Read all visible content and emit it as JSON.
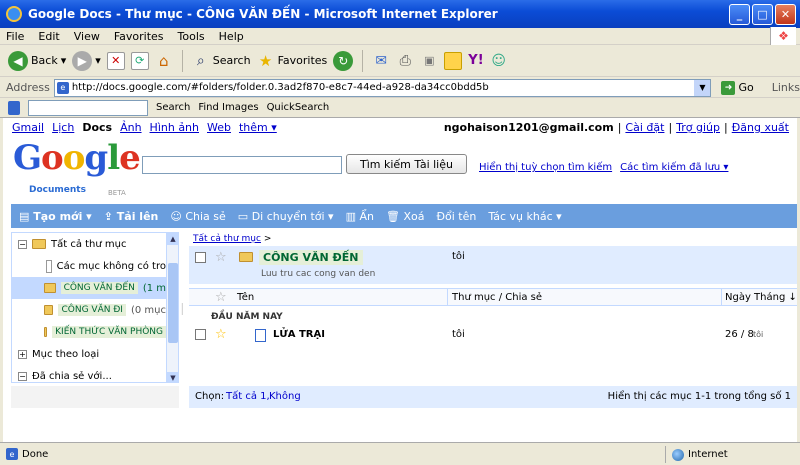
{
  "window": {
    "title": "Google Docs - Thư mục - CÔNG VĂN ĐẾN - Microsoft Internet Explorer"
  },
  "menu": [
    "File",
    "Edit",
    "View",
    "Favorites",
    "Tools",
    "Help"
  ],
  "toolbar": {
    "back": "Back",
    "search": "Search",
    "favorites": "Favorites"
  },
  "address": {
    "label": "Address",
    "url": "http://docs.google.com/#folders/folder.0.3ad2f870-e8c7-44ed-a928-da34cc0bdd5b",
    "go": "Go",
    "links": "Links"
  },
  "gtoolbar": {
    "search": "Search",
    "find_images": "Find Images",
    "quicksearch": "QuickSearch"
  },
  "topnav": {
    "gmail": "Gmail",
    "lich": "Lịch",
    "docs": "Docs",
    "anh": "Ảnh",
    "hinhanh": "Hình ảnh",
    "web": "Web",
    "them": "thêm ▾"
  },
  "account": {
    "email": "ngohaison1201@gmail.com",
    "settings": "Cài đặt",
    "help": "Trợ giúp",
    "signout": "Đăng xuất"
  },
  "logo": {
    "text": "Google",
    "sub": "Documents",
    "beta": "BETA"
  },
  "search": {
    "button": "Tìm kiếm Tài liệu",
    "options": "Hiển thị tuỳ chọn tìm kiếm",
    "saved": "Các tìm kiếm đã lưu ▾"
  },
  "actions": {
    "create": "Tạo mới ▾",
    "upload": "Tải lên",
    "share": "Chia sẻ",
    "move": "Di chuyển tới ▾",
    "hide": "Ẩn",
    "delete": "Xoá",
    "rename": "Đổi tên",
    "more": "Tác vụ khác ▾"
  },
  "tree": {
    "all": "Tất cả thư mục",
    "unfiled": "Các mục không có tro",
    "folders": [
      {
        "name": "CÔNG VĂN ĐẾN",
        "count": "(1 m"
      },
      {
        "name": "CÔNG VĂN ĐI",
        "count": "(0 mục"
      },
      {
        "name": "KIẾN THỨC VĂN PHÒNG",
        "count": ""
      }
    ],
    "by_type": "Mục theo loại",
    "shared": "Đã chia sẻ với..."
  },
  "breadcrumb": {
    "link": "Tất cả thư mục",
    "arrow": ">"
  },
  "current_folder": {
    "name": "CÔNG VĂN ĐẾN",
    "owner": "tôi",
    "description": "Luu tru cac cong van den"
  },
  "columns": {
    "name": "Tên",
    "folder": "Thư mục / Chia sẻ",
    "date": "Ngày Tháng ↓"
  },
  "group": "ĐẦU NĂM NAY",
  "rows": [
    {
      "name": "LỬA TRẠI",
      "owner": "tôi",
      "date": "26 / 8",
      "by": "tôi"
    }
  ],
  "footer": {
    "label": "Chọn:",
    "all": "Tất cả 1,",
    "none": "Không",
    "summary": "Hiển thị các mục 1-1 trong tổng số 1"
  },
  "status": {
    "done": "Done",
    "zone": "Internet"
  }
}
